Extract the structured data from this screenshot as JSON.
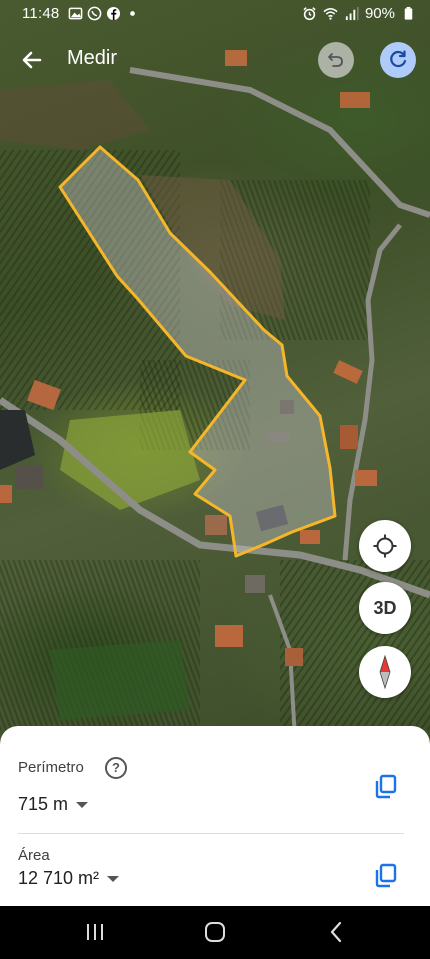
{
  "status_bar": {
    "time": "11:48",
    "battery": "90%",
    "left_icons": [
      "gallery-icon",
      "whatsapp-icon",
      "facebook-icon",
      "dot-icon"
    ],
    "right_icons": [
      "alarm-icon",
      "wifi-icon",
      "signal-icon",
      "battery-icon"
    ]
  },
  "app_bar": {
    "title": "Medir",
    "back_icon": "arrow-left-icon",
    "undo_icon": "undo-icon",
    "redo_icon": "redo-icon"
  },
  "map_controls": {
    "locate_icon": "my-location-icon",
    "view_3d_label": "3D",
    "compass_icon": "compass-icon"
  },
  "measurements": {
    "perimeter_label": "Perímetro",
    "perimeter_value": "715 m",
    "area_label": "Área",
    "area_value": "12 710 m²",
    "help_icon": "help-circle-icon",
    "copy_icon": "copy-icon"
  },
  "colors": {
    "outline": "#f6b629",
    "accent_blue": "#1a73e8",
    "redo_bg": "#aecbfa"
  },
  "nav_bar": {
    "icons": [
      "recents-icon",
      "home-icon",
      "back-icon"
    ]
  }
}
